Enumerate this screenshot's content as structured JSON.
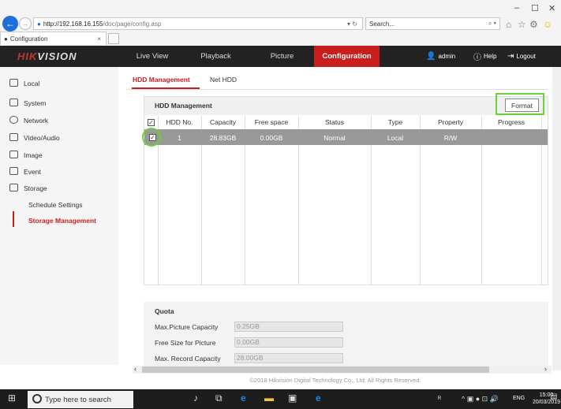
{
  "browser": {
    "url_host": "http://192.168.16.155",
    "url_path": "/doc/page/config.asp",
    "search_placeholder": "Search...",
    "tab_title": "Configuration",
    "tab_close": "×",
    "window_controls": {
      "minimize": "–",
      "maximize": "☐",
      "close": "✕"
    }
  },
  "app": {
    "logo_hik": "HIK",
    "logo_rest": "VISION",
    "nav": [
      "Live View",
      "Playback",
      "Picture",
      "Configuration"
    ],
    "user": "admin",
    "help": "Help",
    "logout": "Logout"
  },
  "sidebar": {
    "items": [
      {
        "label": "Local",
        "icon": "monitor-icon"
      },
      {
        "label": "System",
        "icon": "system-icon"
      },
      {
        "label": "Network",
        "icon": "globe-icon"
      },
      {
        "label": "Video/Audio",
        "icon": "video-audio-icon"
      },
      {
        "label": "Image",
        "icon": "image-icon"
      },
      {
        "label": "Event",
        "icon": "event-icon"
      },
      {
        "label": "Storage",
        "icon": "storage-icon"
      }
    ],
    "sub_items": [
      "Schedule Settings",
      "Storage Management"
    ]
  },
  "content": {
    "tabs": [
      "HDD Management",
      "Net HDD"
    ],
    "panel_title": "HDD Management",
    "format_label": "Format",
    "columns": [
      "HDD No.",
      "Capacity",
      "Free space",
      "Status",
      "Type",
      "Property",
      "Progress"
    ],
    "rows": [
      {
        "hdd_no": "1",
        "capacity": "28.83GB",
        "free_space": "0.00GB",
        "status": "Normal",
        "type": "Local",
        "property": "R/W",
        "progress": ""
      }
    ],
    "checkmark": "✓"
  },
  "quota": {
    "title": "Quota",
    "items": [
      {
        "label": "Max.Picture Capacity",
        "value": "0.25GB"
      },
      {
        "label": "Free Size for Picture",
        "value": "0.00GB"
      },
      {
        "label": "Max. Record Capacity",
        "value": "28.00GB"
      }
    ]
  },
  "footer": "©2018 Hikvision Digital Technology Co., Ltd. All Rights Reserved.",
  "taskbar": {
    "search": "Type here to search",
    "lang": "ENG",
    "time": "15:00",
    "date": "20/03/2019"
  },
  "colors": {
    "accent": "#c81e1e",
    "highlight": "#6ad13c",
    "header": "#222222"
  }
}
